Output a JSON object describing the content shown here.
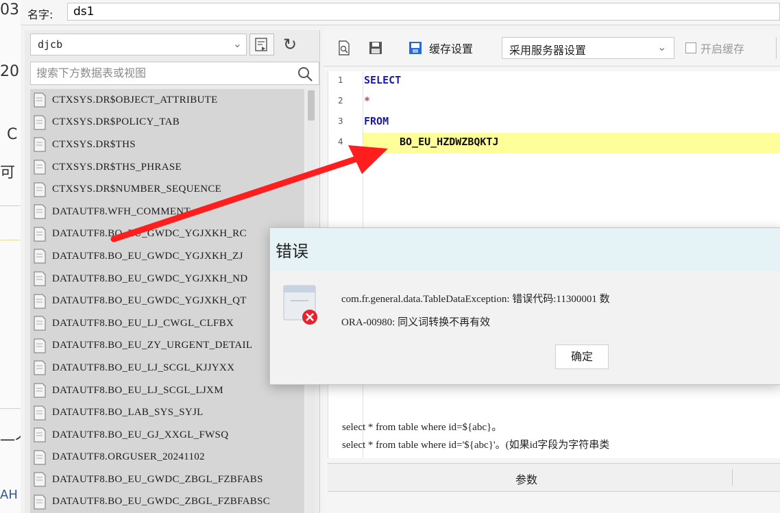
{
  "background": {
    "fragments": [
      "03",
      "20",
      "C",
      "可",
      "一个",
      "AH"
    ]
  },
  "name_field": {
    "label": "名字:",
    "value": "ds1"
  },
  "connection": {
    "selected": "djcb"
  },
  "search": {
    "placeholder": "搜索下方数据表或视图"
  },
  "tables": [
    "CTXSYS.DR$OBJECT_ATTRIBUTE",
    "CTXSYS.DR$POLICY_TAB",
    "CTXSYS.DR$THS",
    "CTXSYS.DR$THS_PHRASE",
    "CTXSYS.DR$NUMBER_SEQUENCE",
    "DATAUTF8.WFH_COMMENT",
    "DATAUTF8.BO_EU_GWDC_YGJXKH_RC",
    "DATAUTF8.BO_EU_GWDC_YGJXKH_ZJ",
    "DATAUTF8.BO_EU_GWDC_YGJXKH_ND",
    "DATAUTF8.BO_EU_GWDC_YGJXKH_QT",
    "DATAUTF8.BO_EU_LJ_CWGL_CLFBX",
    "DATAUTF8.BO_EU_ZY_URGENT_DETAIL",
    "DATAUTF8.BO_EU_LJ_SCGL_KJJYXX",
    "DATAUTF8.BO_EU_LJ_SCGL_LJXM",
    "DATAUTF8.BO_LAB_SYS_SYJL",
    "DATAUTF8.BO_EU_GJ_XXGL_FWSQ",
    "DATAUTF8.ORGUSER_20241102",
    "DATAUTF8.BO_EU_GWDC_ZBGL_FZBFABS",
    "DATAUTF8.BO_EU_GWDC_ZBGL_FZBFABSC"
  ],
  "toolbar": {
    "cache_label": "缓存设置",
    "cache_mode": "采用服务器设置",
    "enable_cache": "开启缓存"
  },
  "editor": {
    "lines": [
      {
        "num": "1",
        "text": "SELECT"
      },
      {
        "num": "2",
        "text": "*"
      },
      {
        "num": "3",
        "text": "FROM"
      },
      {
        "num": "4",
        "text": "BO_EU_HZDWZBQKTJ"
      }
    ],
    "hints": [
      "select * from table where id=${abc}。",
      "select * from table where id='${abc}'。(如果id字段为字符串类"
    ]
  },
  "params": {
    "header": "参数"
  },
  "dialog": {
    "title": "错误",
    "message_line1": "com.fr.general.data.TableDataException: 错误代码:11300001 数",
    "message_line2": "ORA-00980: 同义词转换不再有效",
    "ok_label": "确定"
  },
  "colors": {
    "arrow": "#ff1e1e",
    "keyword": "#1a1aa6",
    "highlight": "#ffff99",
    "error": "#e8212e"
  }
}
